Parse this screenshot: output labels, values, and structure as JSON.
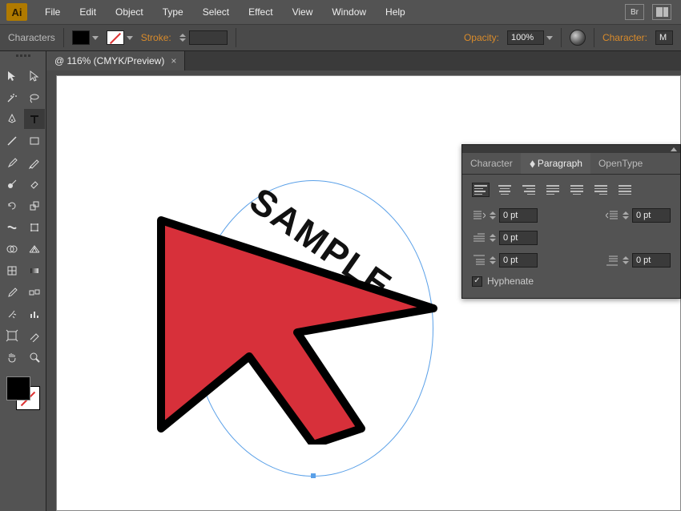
{
  "app": {
    "badge": "Ai"
  },
  "menu": {
    "items": [
      "File",
      "Edit",
      "Object",
      "Type",
      "Select",
      "Effect",
      "View",
      "Window",
      "Help"
    ],
    "bridge_label": "Br"
  },
  "options": {
    "label_left": "Characters",
    "stroke_label": "Stroke:",
    "stroke_value": "",
    "opacity_label": "Opacity:",
    "opacity_value": "100%",
    "character_label": "Character:",
    "character_value": "M"
  },
  "document": {
    "tab_title": "@ 116% (CMYK/Preview)",
    "canvas_text": "SAMPLE"
  },
  "panel": {
    "tabs": {
      "character": "Character",
      "paragraph": "Paragraph",
      "opentype": "OpenType",
      "active": "paragraph"
    },
    "indent_left": "0 pt",
    "indent_right": "0 pt",
    "indent_first": "0 pt",
    "space_before": "0 pt",
    "space_after": "0 pt",
    "hyphenate_label": "Hyphenate",
    "hyphenate_checked": true
  }
}
